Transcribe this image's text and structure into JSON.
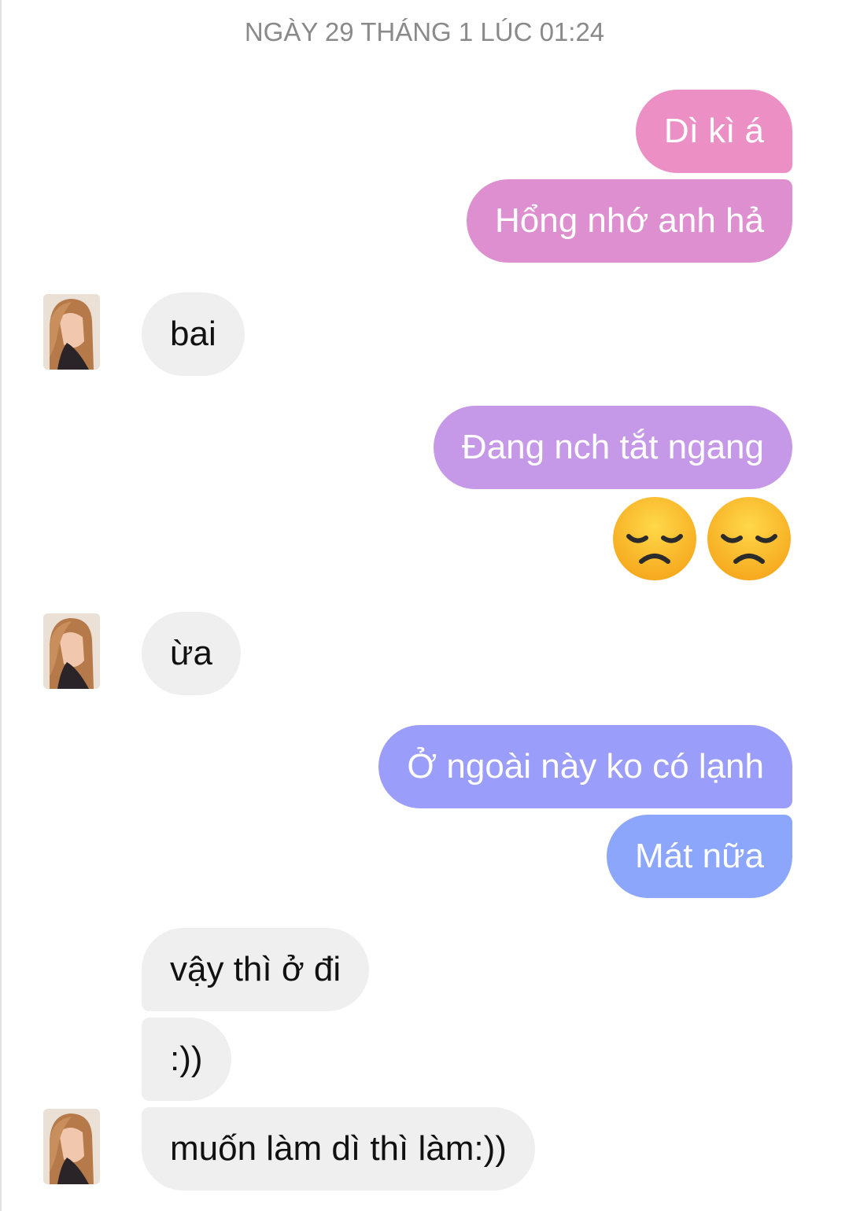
{
  "conversation": {
    "timestamp": "NGÀY 29 THÁNG 1 LÚC 01:24",
    "messages": [
      {
        "sender": "me",
        "text": "Dì kì á",
        "color": "#ec8fc4"
      },
      {
        "sender": "me",
        "text": "Hổng nhớ anh hả",
        "color": "#de8fd0"
      },
      {
        "sender": "them",
        "text": "bai"
      },
      {
        "sender": "me",
        "text": "Đang nch tắt ngang",
        "color": "#c598e8"
      },
      {
        "sender": "me",
        "emoji": [
          "pensive-face",
          "pensive-face"
        ]
      },
      {
        "sender": "them",
        "text": "ừa"
      },
      {
        "sender": "me",
        "text": "Ở ngoài này ko có lạnh",
        "color": "#9b9dfa"
      },
      {
        "sender": "me",
        "text": "Mát nữa",
        "color": "#8ba6fb"
      },
      {
        "sender": "them",
        "text": "vậy thì ở đi"
      },
      {
        "sender": "them",
        "text": ":))"
      },
      {
        "sender": "them",
        "text": "muốn làm dì thì làm:))"
      }
    ]
  },
  "colors": {
    "received_bubble": "#efefef",
    "timestamp_text": "#8a8a8a",
    "emoji_face": "#ffc62f"
  }
}
